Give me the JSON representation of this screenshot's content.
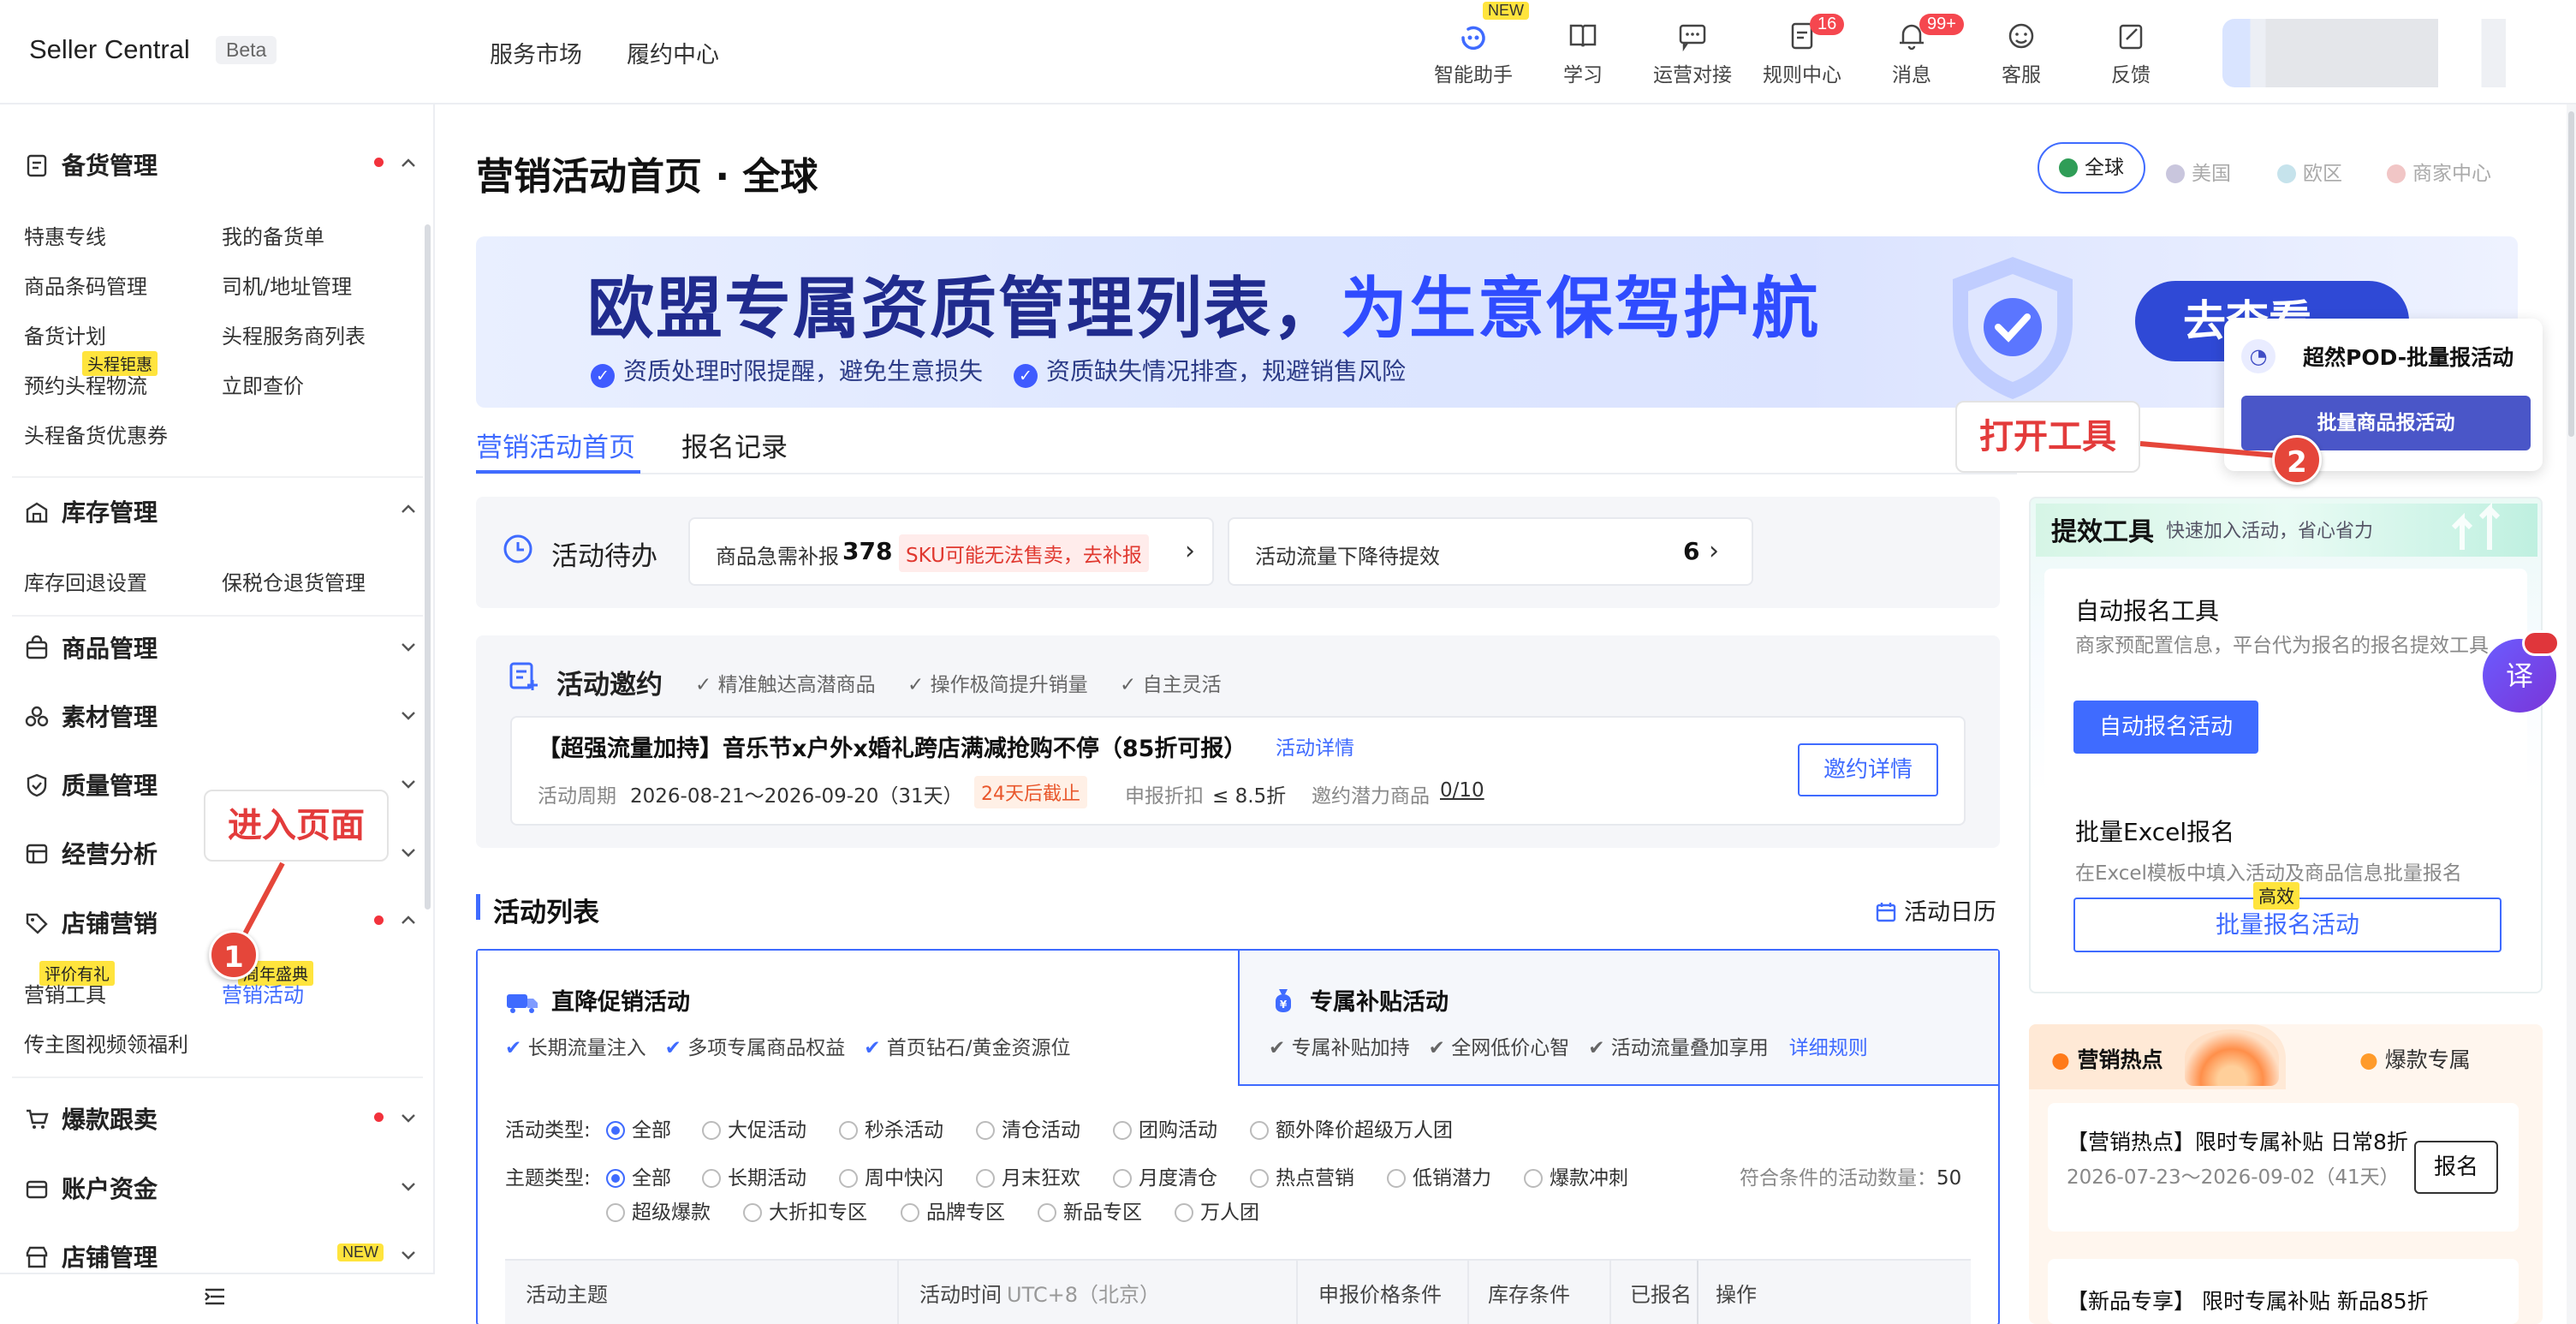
{
  "header": {
    "brand": "Seller Central",
    "beta": "Beta",
    "nav": [
      "服务市场",
      "履约中心"
    ],
    "icons": [
      {
        "label": "智能助手",
        "icon": "assistant-icon",
        "tag": "NEW"
      },
      {
        "label": "学习",
        "icon": "book-icon"
      },
      {
        "label": "运营对接",
        "icon": "chat-icon"
      },
      {
        "label": "规则中心",
        "icon": "rules-icon",
        "badge": "16"
      },
      {
        "label": "消息",
        "icon": "bell-icon",
        "badge": "99+"
      },
      {
        "label": "客服",
        "icon": "service-icon"
      },
      {
        "label": "反馈",
        "icon": "feedback-icon"
      }
    ]
  },
  "sidebar": {
    "sections": [
      {
        "title": "备货管理",
        "dot": true
      },
      {
        "title": "库存管理"
      },
      {
        "title": "商品管理"
      },
      {
        "title": "素材管理"
      },
      {
        "title": "质量管理"
      },
      {
        "title": "经营分析"
      },
      {
        "title": "店铺营销",
        "dot": true
      },
      {
        "title": "爆款跟卖",
        "dot": true
      },
      {
        "title": "账户资金"
      },
      {
        "title": "店铺管理",
        "tag": "NEW"
      }
    ],
    "stock_items": [
      "特惠专线",
      "我的备货单",
      "商品条码管理",
      "司机/地址管理",
      "备货计划",
      "头程服务商列表",
      "预约头程物流",
      "立即查价",
      "头程备货优惠券"
    ],
    "stock_tag": "头程钜惠",
    "inventory_items": [
      "库存回退设置",
      "保税仓退货管理"
    ],
    "marketing_items": [
      "营销工具",
      "营销活动",
      "传主图视频领福利"
    ],
    "marketing_tags": [
      "评价有礼",
      "周年盛典"
    ]
  },
  "page": {
    "title": "营销活动首页 · 全球",
    "regions": [
      "全球",
      "美国",
      "欧区",
      "商家中心"
    ],
    "region_colors": [
      "#2f9d57",
      "#8b86b4",
      "#8cc7d8",
      "#e98a8a"
    ],
    "banner": {
      "title_a": "欧盟专属资质管理列表，",
      "title_b": "为生意保驾护航",
      "sub1": "资质处理时限提醒，避免生意损失",
      "sub2": "资质缺失情况排查，规避销售风险",
      "button": "去查看"
    },
    "tabs": [
      "营销活动首页",
      "报名记录"
    ],
    "todo": {
      "title": "活动待办",
      "item1_label": "商品急需补报",
      "item1_count": "378",
      "item1_warn": "SKU可能无法售卖，去补报",
      "item2_label": "活动流量下降待提效",
      "item2_count": "6"
    },
    "invite": {
      "title": "活动邀约",
      "checks": [
        "精准触达高潜商品",
        "操作极简提升销量",
        "自主灵活"
      ],
      "headline": "【超强流量加持】音乐节x户外x婚礼跨店满减抢购不停（85折可报）",
      "detail_link": "活动详情",
      "period_label": "活动周期",
      "period": "2026-08-21～2026-09-20（31天）",
      "deadline": "24天后截止",
      "discount_label": "申报折扣",
      "discount": "≤ 8.5折",
      "potential_label": "邀约潜力商品",
      "potential": "0/10",
      "button": "邀约详情"
    },
    "list": {
      "title": "活动列表",
      "calendar": "活动日历",
      "tab1": {
        "title": "直降促销活动",
        "checks": [
          "长期流量注入",
          "多项专属商品权益",
          "首页钻石/黄金资源位"
        ]
      },
      "tab2": {
        "title": "专属补贴活动",
        "checks": [
          "专属补贴加持",
          "全网低价心智",
          "活动流量叠加享用"
        ],
        "link": "详细规则"
      },
      "type_label": "活动类型:",
      "types": [
        "全部",
        "大促活动",
        "秒杀活动",
        "清仓活动",
        "团购活动",
        "额外降价超级万人团"
      ],
      "theme_label": "主题类型:",
      "themes": [
        "全部",
        "长期活动",
        "周中快闪",
        "月末狂欢",
        "月度清仓",
        "热点营销",
        "低销潜力",
        "爆款冲刺",
        "超级爆款",
        "大折扣专区",
        "品牌专区",
        "新品专区",
        "万人团"
      ],
      "count_label": "符合条件的活动数量：",
      "count": "50",
      "columns": [
        "活动主题",
        "活动时间",
        "UTC+8（北京）",
        "申报价格条件",
        "库存条件",
        "已报名",
        "操作"
      ]
    }
  },
  "tools": {
    "title": "提效工具",
    "subtitle": "快速加入活动，省心省力",
    "auto_title": "自动报名工具",
    "auto_desc": "商家预配置信息，平台代为报名的报名提效工具",
    "auto_button": "自动报名活动",
    "excel_title": "批量Excel报名",
    "excel_desc": "在Excel模板中填入活动及商品信息批量报名",
    "excel_tag": "高效",
    "excel_button": "批量报名活动"
  },
  "popup": {
    "title": "超然POD-批量报活动",
    "button": "批量商品报活动"
  },
  "hot": {
    "tab1": "营销热点",
    "tab2": "爆款专属",
    "card1_title": "【营销热点】限时专属补贴 日常8折",
    "card1_date": "2026-07-23～2026-09-02（41天）",
    "card1_button": "报名",
    "card2_title": "【新品专享】 限时专属补贴 新品85折"
  },
  "annotations": {
    "c1_text": "进入页面",
    "c1_num": "1",
    "c2_text": "打开工具",
    "c2_num": "2"
  },
  "floating": {
    "translate": "译"
  }
}
